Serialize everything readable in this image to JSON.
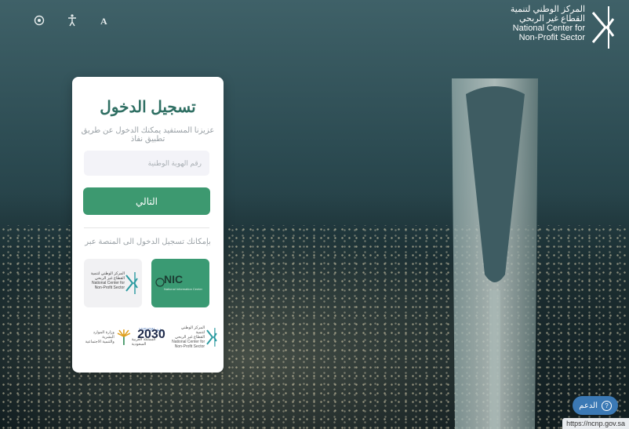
{
  "header": {
    "icons": [
      "settings-icon",
      "accessibility-icon",
      "font-size-icon"
    ],
    "brand": {
      "ar_line1": "المركز الوطني لتنمية",
      "ar_line2": "القطاع غير الربحي",
      "en_line1": "National Center for",
      "en_line2": "Non-Profit Sector"
    }
  },
  "login": {
    "title": "تسجيل الدخول",
    "subtitle": "عزيزنا المستفيد يمكنك الدخول عن طريق تطبيق نفاذ",
    "id_placeholder": "رقم الهوية الوطنية",
    "next_label": "التالي",
    "via_label": "بإمكانك تسجيل الدخول الى المنصة عبر",
    "nic": {
      "label": "NIC",
      "sub": "National Information Center"
    },
    "ncnp": {
      "ar_line1": "المركز الوطني لتنمية",
      "ar_line2": "القطاع غير الربحي",
      "en_line1": "National Center for",
      "en_line2": "Non-Profit Sector"
    },
    "footer": {
      "ncnp_ar1": "المركز الوطني لتنمية",
      "ncnp_ar2": "القطاع غير الربحي",
      "ncnp_en1": "National Center for",
      "ncnp_en2": "Non-Profit Sector",
      "vision_top": "VISION رؤية",
      "vision_year": "2030",
      "vision_sub": "المملكة العربية السعودية",
      "hrsd_ar1": "وزارة الموارد البشرية",
      "hrsd_ar2": "والتنمية الاجتماعية"
    }
  },
  "support": {
    "label": "الدعم"
  },
  "status_url": "https://ncnp.gov.sa",
  "colors": {
    "primary": "#3d9970",
    "title": "#2f6f63",
    "support": "#3b79b5"
  }
}
